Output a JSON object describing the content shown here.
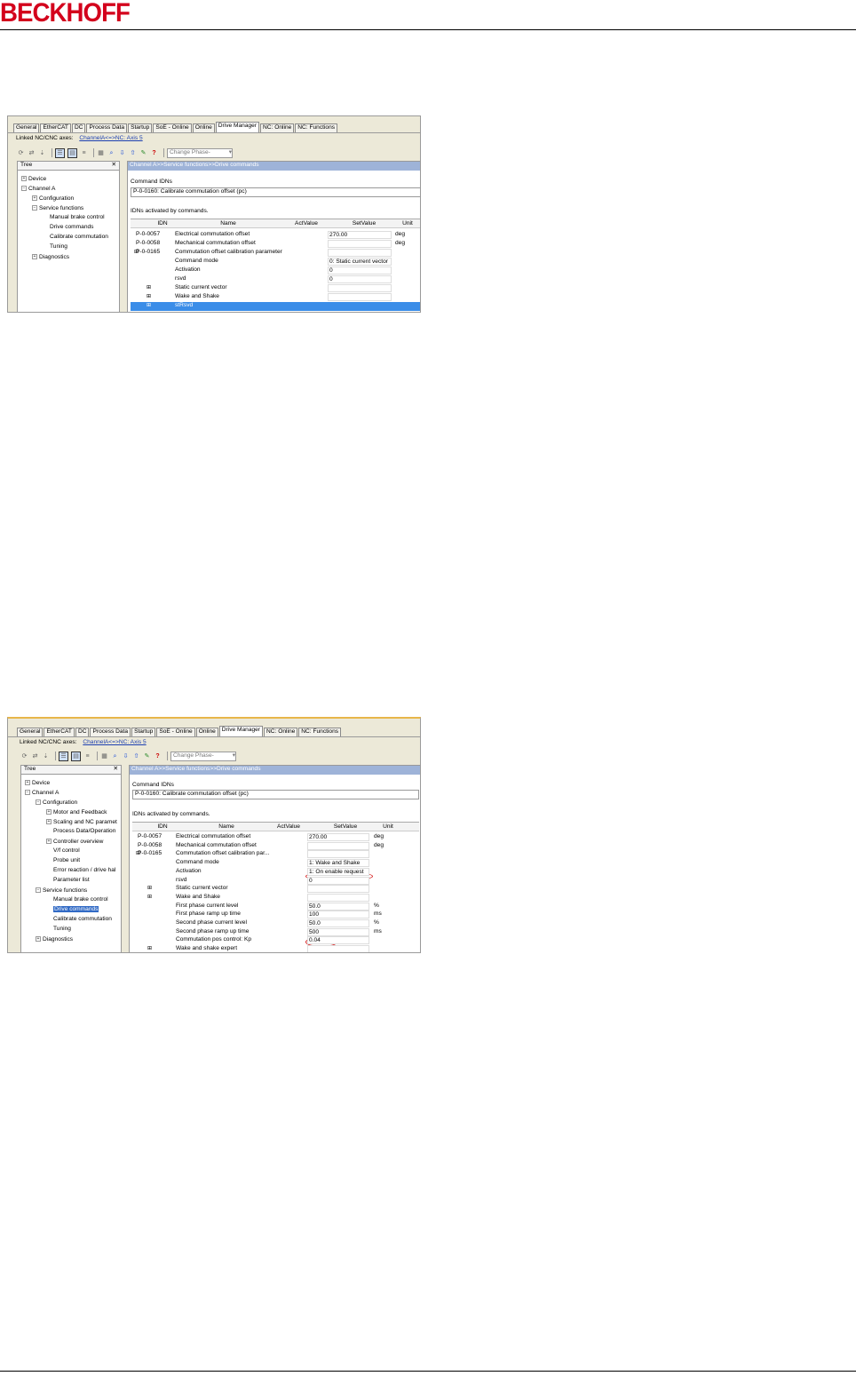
{
  "brand": {
    "logo_text": "BECKHOFF"
  },
  "screen1": {
    "tabs": [
      "General",
      "EtherCAT",
      "DC",
      "Process Data",
      "Startup",
      "SoE - Online",
      "Online",
      "Drive Manager",
      "NC: Online",
      "NC: Functions"
    ],
    "active_tab": "Drive Manager",
    "linked_label": "Linked NC/CNC axes:",
    "linked_value": "ChannelA<=>NC: Axis 5",
    "change_phase": "Change Phase-",
    "tree_title": "Tree",
    "tree_close": "✕",
    "tree_items": [
      "Device",
      "Channel A",
      "Configuration",
      "Service functions",
      "Manual brake control",
      "Drive commands",
      "Calibrate commutation",
      "Tuning",
      "Diagnostics"
    ],
    "breadcrumb": "Channel A>>Service functions>>Drive commands",
    "command_idns_label": "Command IDNs",
    "command_idn": "P-0-0160: Calibrate commutation offset (pc)",
    "activated_label": "IDNs activated by commands.",
    "columns": [
      "IDN",
      "Name",
      "ActValue",
      "SetValue",
      "Unit"
    ],
    "rows": [
      {
        "idn": "P-0-0057",
        "name": "Electrical commutation offset",
        "set": "270.00",
        "unit": "deg"
      },
      {
        "idn": "P-0-0058",
        "name": "Mechanical commutation offset",
        "set": "",
        "unit": "deg"
      },
      {
        "idn": "P-0-0165",
        "name": "Commutation offset calibration parameter",
        "set": "",
        "unit": ""
      },
      {
        "idn": "",
        "name": "Command mode",
        "set": "0: Static current vector",
        "unit": ""
      },
      {
        "idn": "",
        "name": "Activation",
        "set": "0",
        "unit": ""
      },
      {
        "idn": "",
        "name": "rsvd",
        "set": "0",
        "unit": ""
      },
      {
        "idn": "",
        "name": "Static current vector",
        "set": "",
        "unit": ""
      },
      {
        "idn": "",
        "name": "Wake and Shake",
        "set": "",
        "unit": ""
      },
      {
        "idn": "",
        "name": "stRsvd",
        "set": "",
        "unit": ""
      }
    ]
  },
  "screen2": {
    "tabs": [
      "General",
      "EtherCAT",
      "DC",
      "Process Data",
      "Startup",
      "SoE - Online",
      "Online",
      "Drive Manager",
      "NC: Online",
      "NC: Functions"
    ],
    "active_tab": "Drive Manager",
    "linked_label": "Linked NC/CNC axes:",
    "linked_value": "ChannelA<=>NC: Axis 5",
    "change_phase": "Change Phase-",
    "tree_title": "Tree",
    "tree_close": "✕",
    "tree_items": [
      "Device",
      "Channel A",
      "Configuration",
      "Motor and Feedback",
      "Scaling and NC paramet",
      "Process Data/Operation",
      "Controller overview",
      "V/f control",
      "Probe unit",
      "Error reaction / drive hal",
      "Parameter list",
      "Service functions",
      "Manual brake control",
      "Drive commands",
      "Calibrate commutation",
      "Tuning",
      "Diagnostics"
    ],
    "breadcrumb": "Channel A>>Service functions>>Drive commands",
    "command_idns_label": "Command IDNs",
    "command_idn": "P-0-0160: Calibrate commutation offset (pc)",
    "activated_label": "IDNs activated by commands.",
    "columns": [
      "IDN",
      "Name",
      "ActValue",
      "SetValue",
      "Unit"
    ],
    "rows": [
      {
        "idn": "P-0-0057",
        "name": "Electrical commutation offset",
        "set": "270.00",
        "unit": "deg"
      },
      {
        "idn": "P-0-0058",
        "name": "Mechanical commutation offset",
        "set": "",
        "unit": "deg"
      },
      {
        "idn": "P-0-0165",
        "name": "Commutation offset calibration par...",
        "set": "",
        "unit": ""
      },
      {
        "idn": "",
        "name": "Command mode",
        "set": "1: Wake and Shake",
        "unit": ""
      },
      {
        "idn": "",
        "name": "Activation",
        "set": "1: On enable request",
        "unit": ""
      },
      {
        "idn": "",
        "name": "rsvd",
        "set": "0",
        "unit": ""
      },
      {
        "idn": "",
        "name": "Static current vector",
        "set": "",
        "unit": ""
      },
      {
        "idn": "",
        "name": "Wake and Shake",
        "set": "",
        "unit": ""
      },
      {
        "idn": "",
        "name": "First phase current level",
        "set": "50.0",
        "unit": "%"
      },
      {
        "idn": "",
        "name": "First phase ramp up time",
        "set": "100",
        "unit": "ms"
      },
      {
        "idn": "",
        "name": "Second phase current level",
        "set": "50.0",
        "unit": "%"
      },
      {
        "idn": "",
        "name": "Second phase ramp up time",
        "set": "500",
        "unit": "ms"
      },
      {
        "idn": "",
        "name": "Commutation pos control: Kp",
        "set": "0.04",
        "unit": ""
      },
      {
        "idn": "",
        "name": "Wake and shake expert",
        "set": "",
        "unit": ""
      }
    ]
  },
  "toolbar_icons": [
    "refresh-icon",
    "sync-icon",
    "download-icon",
    "tree-view-icon",
    "list-view-icon",
    "hierarchy-icon",
    "grid-icon",
    "search-icon",
    "import-icon",
    "export-icon",
    "tools-icon",
    "help-icon"
  ],
  "colors": {
    "brand_red": "#d3001c",
    "selection_blue": "#316ac5",
    "highlight_row": "#3b8de8",
    "annotation_red": "#d62020"
  }
}
